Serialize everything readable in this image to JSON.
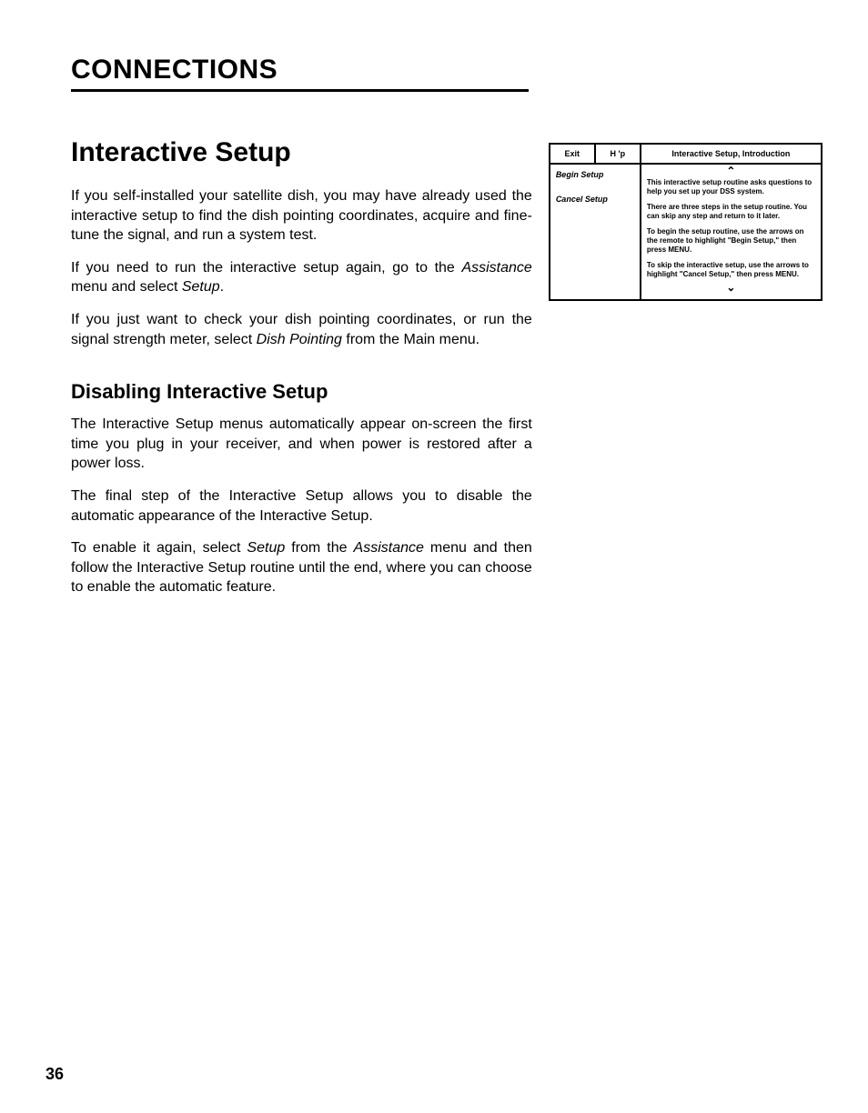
{
  "chapter": "CONNECTIONS",
  "section1": {
    "title": "Interactive Setup",
    "p1a": "If you self-installed your satellite dish, you may have already used the interactive setup to find the dish pointing coordinates, acquire and fine-tune the signal, and run a system test.",
    "p2a": "If you need to run the interactive setup again, go to the ",
    "p2_i1": "Assistance",
    "p2b": " menu and select ",
    "p2_i2": "Setup",
    "p2c": ".",
    "p3a": "If you just want to check your dish pointing coordinates, or run the signal strength meter, select ",
    "p3_i1": "Dish Pointing",
    "p3b": " from the Main menu."
  },
  "section2": {
    "title": "Disabling Interactive Setup",
    "p1": "The Interactive Setup menus automatically appear on-screen the first time you plug in your receiver, and when power is restored after a power loss.",
    "p2": "The final step of the Interactive Setup allows you to disable the automatic appearance of the Interactive Setup.",
    "p3a": "To enable it again, select ",
    "p3_i1": "Setup",
    "p3b": " from the ",
    "p3_i2": "Assistance",
    "p3c": " menu and then follow the Interactive Setup routine until the end, where you can choose to enable the automatic feature."
  },
  "figure": {
    "tab_exit": "Exit",
    "tab_help": "H 'p",
    "left_item1": "Begin Setup",
    "left_item2": "Cancel Setup",
    "right_title": "Interactive Setup, Introduction",
    "arrow_up": "⌃",
    "arrow_down": "⌄",
    "r1": "This interactive setup routine asks questions to help you set up your DSS system.",
    "r2": "There are three steps in the setup routine. You can skip any step and return to it later.",
    "r3": "To begin the setup routine, use the arrows on the remote to highlight \"Begin Setup,\" then press MENU.",
    "r4": "To skip the interactive setup, use the arrows to highlight \"Cancel Setup,\" then press MENU."
  },
  "page_number": "36"
}
